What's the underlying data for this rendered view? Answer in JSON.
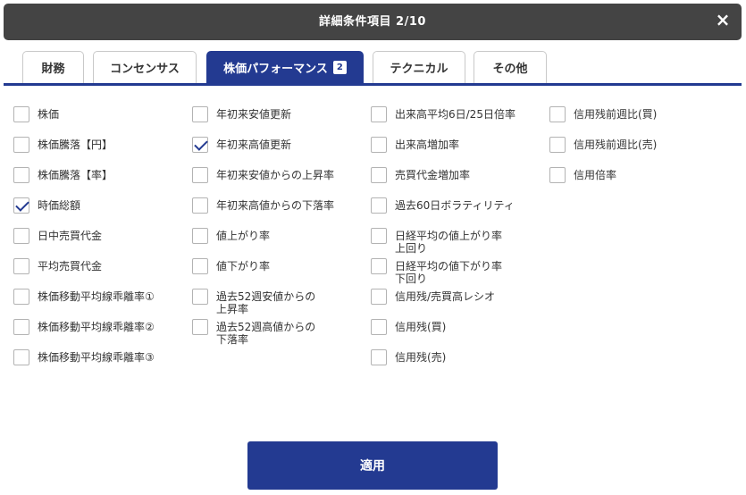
{
  "header": {
    "title": "詳細条件項目 2/10",
    "close_icon": "×"
  },
  "tabs": [
    {
      "label": "財務"
    },
    {
      "label": "コンセンサス"
    },
    {
      "label": "株価パフォーマンス",
      "badge": "2",
      "active": true
    },
    {
      "label": "テクニカル"
    },
    {
      "label": "その他"
    }
  ],
  "columns": [
    [
      {
        "label": "株価",
        "checked": false
      },
      {
        "label": "株価騰落【円】",
        "checked": false
      },
      {
        "label": "株価騰落【率】",
        "checked": false
      },
      {
        "label": "時価総額",
        "checked": true
      },
      {
        "label": "日中売買代金",
        "checked": false
      },
      {
        "label": "平均売買代金",
        "checked": false
      },
      {
        "label": "株価移動平均線乖離率①",
        "checked": false
      },
      {
        "label": "株価移動平均線乖離率②",
        "checked": false
      },
      {
        "label": "株価移動平均線乖離率③",
        "checked": false
      }
    ],
    [
      {
        "label": "年初来安値更新",
        "checked": false
      },
      {
        "label": "年初来高値更新",
        "checked": true
      },
      {
        "label": "年初来安値からの上昇率",
        "checked": false
      },
      {
        "label": "年初来高値からの下落率",
        "checked": false
      },
      {
        "label": "値上がり率",
        "checked": false
      },
      {
        "label": "値下がり率",
        "checked": false
      },
      {
        "label": "過去52週安値からの\n上昇率",
        "checked": false
      },
      {
        "label": "過去52週高値からの\n下落率",
        "checked": false
      }
    ],
    [
      {
        "label": "出来高平均6日/25日倍率",
        "checked": false
      },
      {
        "label": "出来高増加率",
        "checked": false
      },
      {
        "label": "売買代金増加率",
        "checked": false
      },
      {
        "label": "過去60日ボラティリティ",
        "checked": false
      },
      {
        "label": "日経平均の値上がり率\n上回り",
        "checked": false
      },
      {
        "label": "日経平均の値下がり率\n下回り",
        "checked": false
      },
      {
        "label": "信用残/売買高レシオ",
        "checked": false
      },
      {
        "label": "信用残(買)",
        "checked": false
      },
      {
        "label": "信用残(売)",
        "checked": false
      }
    ],
    [
      {
        "label": "信用残前週比(買)",
        "checked": false
      },
      {
        "label": "信用残前週比(売)",
        "checked": false
      },
      {
        "label": "信用倍率",
        "checked": false
      }
    ]
  ],
  "apply_button": {
    "label": "適用"
  },
  "colors": {
    "accent": "#233a91",
    "header_bg": "#444444"
  }
}
